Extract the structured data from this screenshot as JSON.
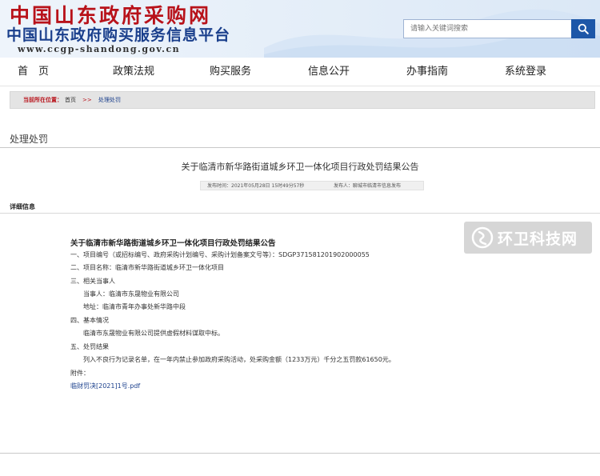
{
  "header": {
    "logo_line1": "中国山东政府采购网",
    "logo_line2": "中国山东政府购买服务信息平台",
    "logo_url": "www.ccgp-shandong.gov.cn",
    "search_placeholder": "请输入关键词搜索",
    "brand_red": "#b8121a",
    "brand_blue": "#1a3f8c",
    "search_button_color": "#1d57a8"
  },
  "nav": {
    "items": [
      "首　页",
      "政策法规",
      "购买服务",
      "信息公开",
      "办事指南",
      "系统登录"
    ]
  },
  "breadcrumb": {
    "label": "当前所在位置：",
    "home": "首页",
    "sep": ">>",
    "current": "处理处罚",
    "label_color": "#b8121a"
  },
  "section": {
    "title": "处理处罚"
  },
  "article": {
    "title": "关于临清市新华路街道城乡环卫一体化项目行政处罚结果公告",
    "publish_time": "发布时间：2021年05月28日 15时49分57秒",
    "publisher": "发布人：聊城市临清市信息发布",
    "detail_label": "详细信息",
    "doc_title": "关于临清市新华路街道城乡环卫一体化项目行政处罚结果公告",
    "lines": [
      "一、项目编号（或招标编号、政府采购计划编号、采购计划备案文号等）：SDGP371581201902000055",
      "二、项目名称：临清市新华路街道城乡环卫一体化项目",
      "三、相关当事人",
      "当事人：临清市东晟物业有限公司",
      "地址：临清市青年办事处新华路中段",
      "四、基本情况",
      "临清市东晟物业有限公司提供虚假材料谋取中标。",
      "五、处罚结果",
      "列入不良行为记录名单，在一年内禁止参加政府采购活动，处采购金额（1233万元）千分之五罚款61650元。",
      "附件："
    ],
    "attachment": "临财罚决[2021]1号.pdf"
  },
  "watermark": {
    "text": "环卫科技网"
  }
}
